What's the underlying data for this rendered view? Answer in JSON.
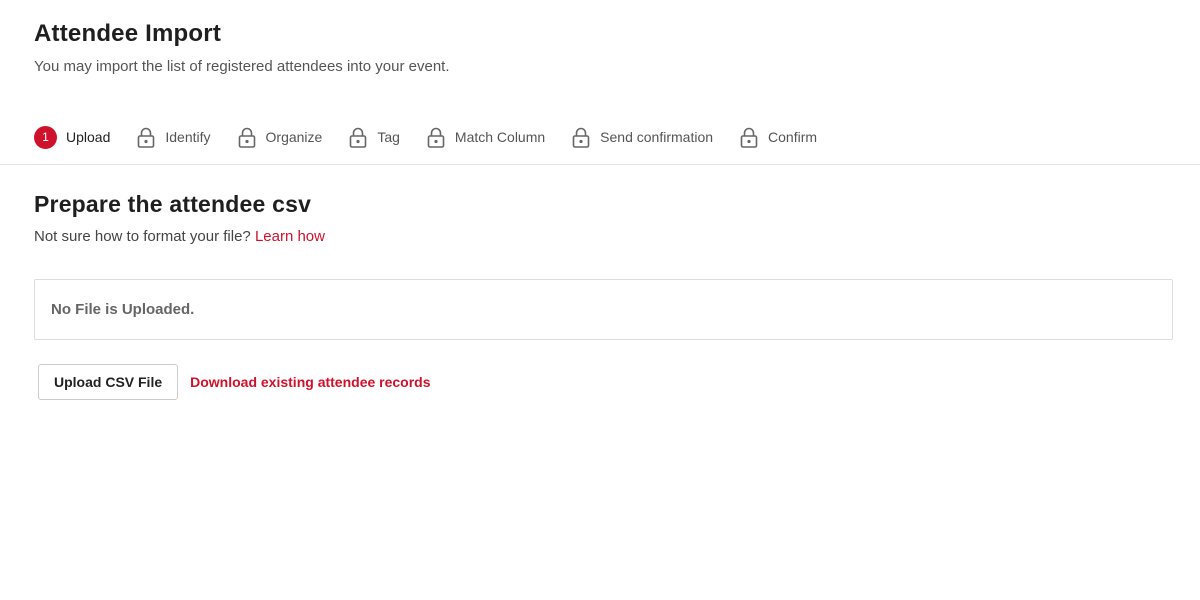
{
  "header": {
    "title": "Attendee Import",
    "subtitle": "You may import the list of registered attendees into your event."
  },
  "stepper": {
    "active_number": "1",
    "steps": [
      {
        "label": "Upload",
        "state": "active"
      },
      {
        "label": "Identify",
        "state": "locked",
        "icon": "lock-icon"
      },
      {
        "label": "Organize",
        "state": "locked",
        "icon": "lock-icon"
      },
      {
        "label": "Tag",
        "state": "locked",
        "icon": "lock-icon"
      },
      {
        "label": "Match Column",
        "state": "locked",
        "icon": "lock-icon"
      },
      {
        "label": "Send confirmation",
        "state": "locked",
        "icon": "lock-icon"
      },
      {
        "label": "Confirm",
        "state": "locked",
        "icon": "lock-icon"
      }
    ]
  },
  "section": {
    "title": "Prepare the attendee csv",
    "help_text": "Not sure how to format your file?",
    "help_link": "Learn how"
  },
  "file_box": {
    "status": "No File is Uploaded."
  },
  "actions": {
    "upload_label": "Upload CSV File",
    "download_label": "Download existing attendee records"
  },
  "colors": {
    "accent": "#d0112b",
    "text": "#1f1f1f",
    "muted": "#555555",
    "border": "#dddddd"
  }
}
